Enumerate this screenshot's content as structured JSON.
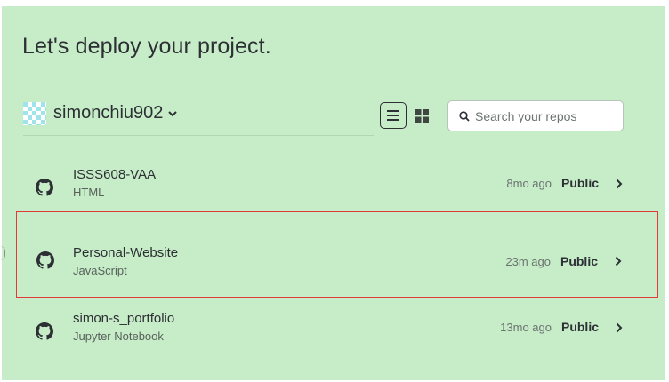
{
  "page": {
    "title": "Let's deploy your project."
  },
  "account": {
    "name": "simonchiu902",
    "avatar_icon": "identicon-avatar",
    "menu_icon": "chevron-down-icon"
  },
  "view_toggle": {
    "list_icon": "list-view-icon",
    "grid_icon": "grid-view-icon",
    "active": "list"
  },
  "search": {
    "placeholder": "Search your repos",
    "value": ""
  },
  "repos": [
    {
      "name": "ISSS608-VAA",
      "language": "HTML",
      "updated": "8mo ago",
      "visibility": "Public",
      "selected": false
    },
    {
      "name": "Personal-Website",
      "language": "JavaScript",
      "updated": "23m ago",
      "visibility": "Public",
      "selected": true
    },
    {
      "name": "simon-s_portfolio",
      "language": "Jupyter Notebook",
      "updated": "13mo ago",
      "visibility": "Public",
      "selected": false
    }
  ],
  "colors": {
    "panel_bg": "#c6ecc8",
    "text": "#2c2f33",
    "selection_border": "#e23a3a"
  }
}
